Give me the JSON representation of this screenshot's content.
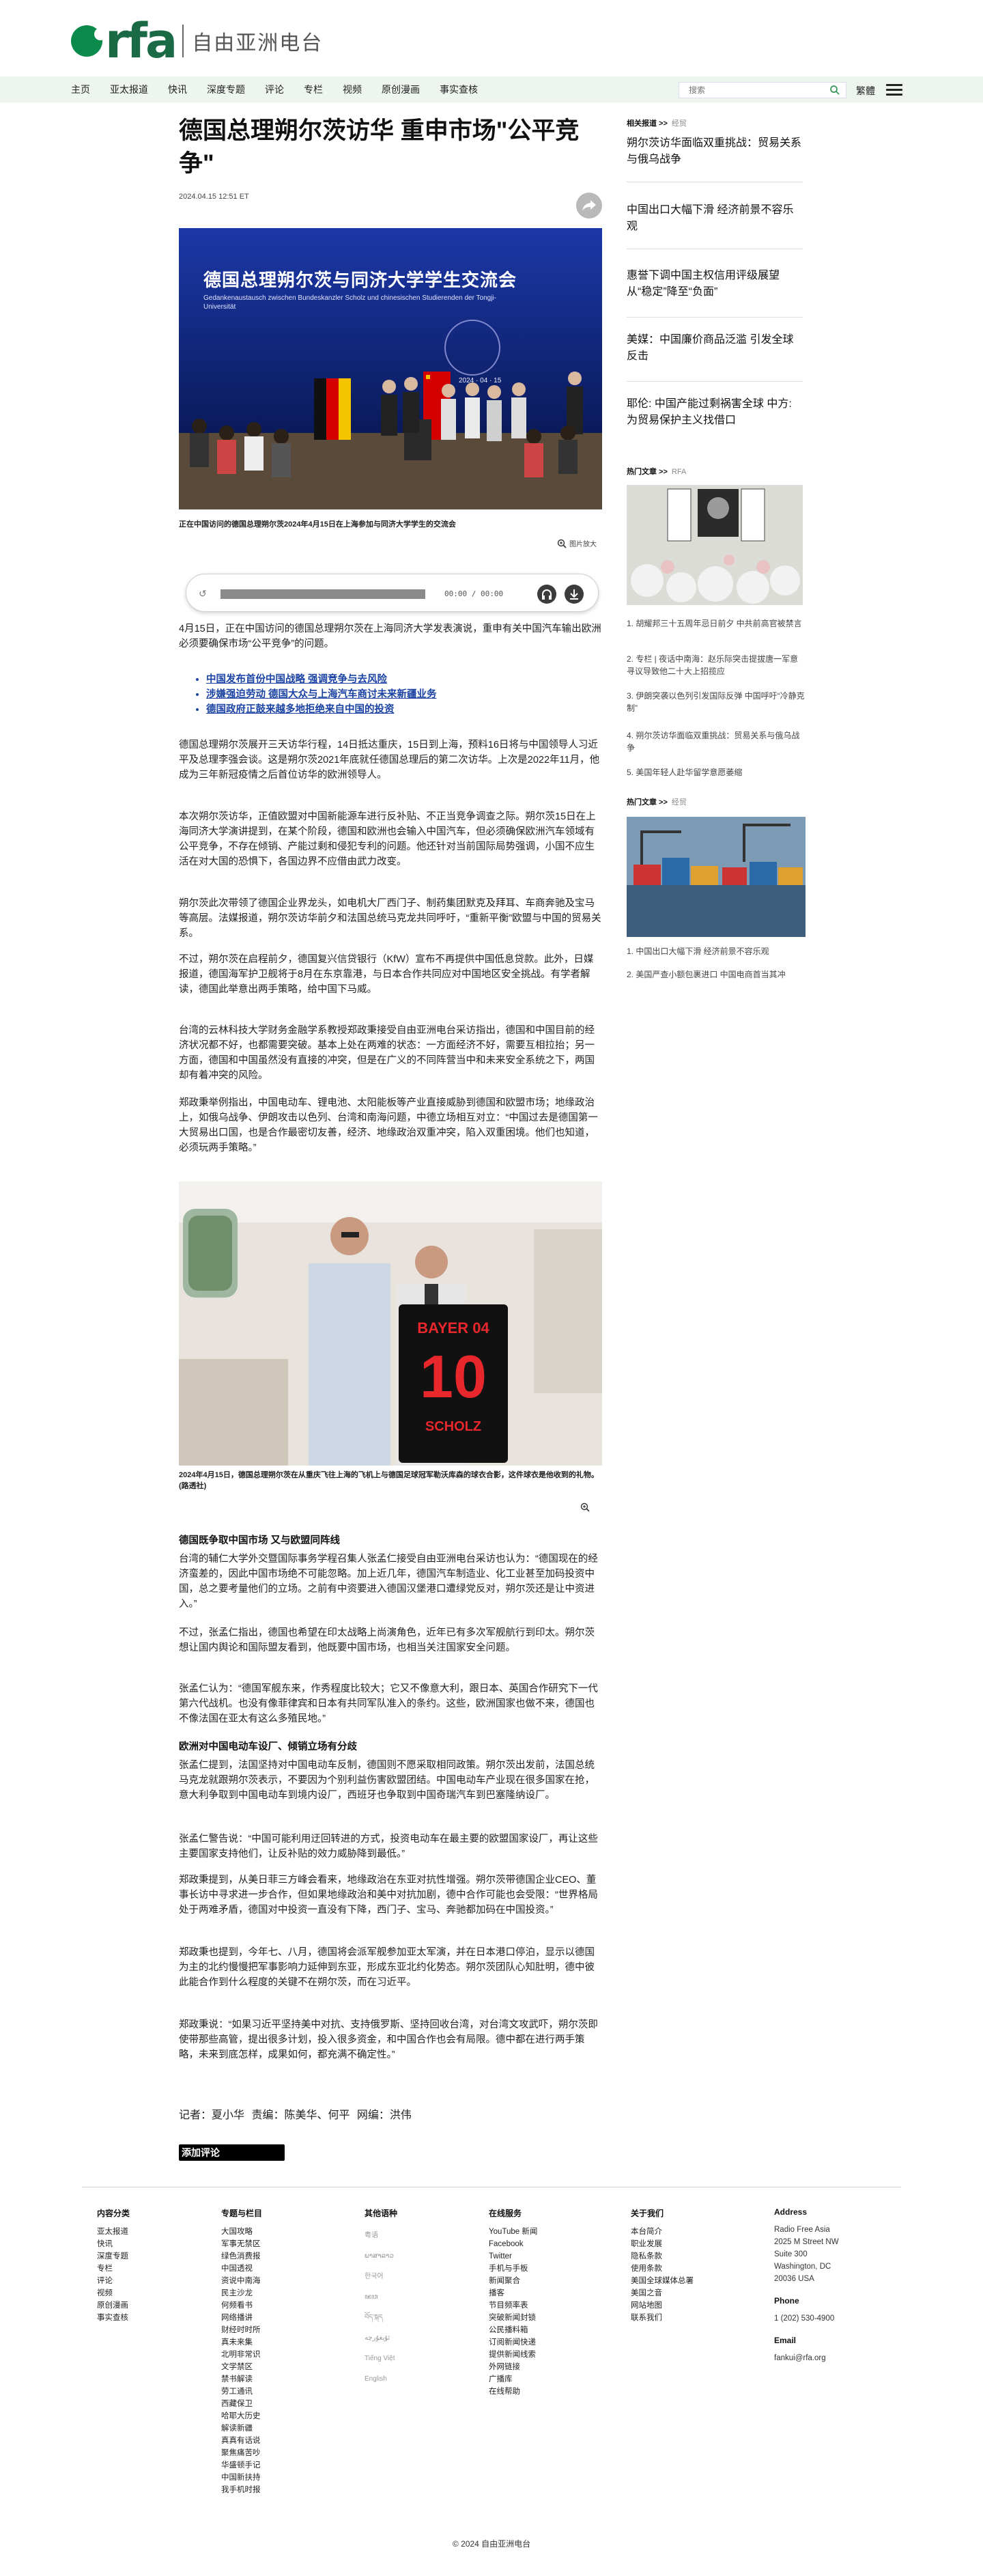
{
  "brand": {
    "logo": "rfa",
    "name": "自由亚洲电台"
  },
  "nav": {
    "items": [
      "主页",
      "亚太报道",
      "快讯",
      "深度专题",
      "评论",
      "专栏",
      "视频",
      "原创漫画",
      "事实查核"
    ],
    "search_placeholder": "搜索",
    "lang_toggle": "繁體"
  },
  "article": {
    "title": "德国总理朔尔茨访华 重申市场\"公平竞争\"",
    "timestamp": "2024.04.15 12:51 ET",
    "image1_caption": "正在中国访问的德国总理朔尔茨2024年4月15日在上海参加与同济大学学生的交流会",
    "image1_banner_cn": "德国总理朔尔茨与同济大学学生交流会",
    "image1_banner_de": "Gedankenaustausch zwischen Bundeskanzler Scholz und chinesischen Studierenden der Tongji-Universität",
    "image1_date": "2024 · 04 · 15",
    "zoom_label": "图片放大",
    "audio_time": "00:00 / 00:00",
    "lead": "4月15日，正在中国访问的德国总理朔尔茨在上海同济大学发表演说，重申有关中国汽车输出欧洲必须要确保市场“公平竞争”的问题。",
    "related": [
      "中国发布首份中国战略 强调竞争与去风险",
      "涉嫌强迫劳动 德国大众与上海汽车商讨未来新疆业务",
      "德国政府正鼓来越多地拒绝来自中国的投资"
    ],
    "paragraphs_a": [
      "德国总理朔尔茨展开三天访华行程，14日抵达重庆，15日到上海，预料16日将与中国领导人习近平及总理李强会谈。这是朔尔茨2021年底就任德国总理后的第二次访华。上次是2022年11月，他成为三年新冠疫情之后首位访华的欧洲领导人。",
      "本次朔尔茨访华，正值欧盟对中国新能源车进行反补贴、不正当竞争调查之际。朔尔茨15日在上海同济大学演讲提到，在某个阶段，德国和欧洲也会输入中国汽车，但必须确保欧洲汽车领域有公平竞争，不存在倾销、产能过剩和侵犯专利的问题。他还针对当前国际局势强调，小国不应生活在对大国的恐惧下，各国边界不应借由武力改变。",
      "朔尔茨此次带领了德国企业界龙头，如电机大厂西门子、制药集团默克及拜耳、车商奔驰及宝马等高层。法媒报道，朔尔茨访华前夕和法国总统马克龙共同呼吁，“重新平衡”欧盟与中国的贸易关系。",
      "不过，朔尔茨在启程前夕，德国复兴信贷银行（KfW）宣布不再提供中国低息贷款。此外，日媒报道，德国海军护卫舰将于8月在东京靠港，与日本合作共同应对中国地区安全挑战。有学者解读，德国此举意出两手策略，给中国下马威。",
      "台湾的云林科技大学财务金融学系教授郑政秉接受自由亚洲电台采访指出，德国和中国目前的经济状况都不好，也都需要突破。基本上处在两难的状态：一方面经济不好，需要互相拉抬；另一方面，德国和中国虽然没有直接的冲突，但是在广义的不同阵营当中和未来安全系统之下，两国却有着冲突的风险。",
      "郑政秉举例指出，中国电动车、锂电池、太阳能板等产业直接威胁到德国和欧盟市场；地缘政治上，如俄乌战争、伊朗攻击以色列、台湾和南海问题，中德立场相互对立：“中国过去是德国第一大贸易出口国，也是合作最密切友善，经济、地缘政治双重冲突，陷入双重困境。他们也知道，必须玩两手策略。”"
    ],
    "image2_caption": "2024年4月15日，德国总理朔尔茨在从重庆飞往上海的飞机上与德国足球冠军勒沃库森的球衣合影，这件球衣是他收到的礼物。(路透社)",
    "jersey_top": "BAYER 04",
    "jersey_number": "10",
    "jersey_name": "SCHOLZ",
    "subhead_1": "德国既争取中国市场 又与欧盟同阵线",
    "paragraphs_b": [
      "台湾的辅仁大学外交暨国际事务学程召集人张孟仁接受自由亚洲电台采访也认为：“德国现在的经济蛮差的，因此中国市场绝不可能忽略。加上近几年，德国汽车制造业、化工业甚至加码投资中国，总之要考量他们的立场。之前有中资要进入德国汉堡港口遭绿党反对，朔尔茨还是让中资进入。”",
      "不过，张孟仁指出，德国也希望在印太战略上尚演角色，近年已有多次军舰航行到印太。朔尔茨想让国内舆论和国际盟友看到，他既要中国市场，也相当关注国家安全问题。",
      "张孟仁认为：“德国军舰东来，作秀程度比较大；它又不像意大利，跟日本、英国合作研究下一代第六代战机。也没有像菲律宾和日本有共同军队准入的条约。这些，欧洲国家也做不来，德国也不像法国在亚太有这么多殖民地。”"
    ],
    "subhead_2": "欧洲对中国电动车设厂、倾销立场有分歧",
    "paragraphs_c": [
      "张孟仁提到，法国坚持对中国电动车反制，德国则不愿采取相同政策。朔尔茨出发前，法国总统马克龙就跟朔尔茨表示，不要因为个别利益伤害欧盟团结。中国电动车产业现在很多国家在抢，意大利争取到中国电动车到境内设厂，西班牙也争取到中国奇瑞汽车到巴塞隆纳设厂。",
      "张孟仁警告说：“中国可能利用迂回转进的方式，投资电动车在最主要的欧盟国家设厂，再让这些主要国家支持他们，让反补贴的效力威胁降到最低。”",
      "郑政秉提到，从美日菲三方峰会看来，地缘政治在东亚对抗性增强。朔尔茨带德国企业CEO、董事长访中寻求进一步合作，但如果地缘政治和美中对抗加剧，德中合作可能也会受限：“世界格局处于两难矛盾，德国对中投资一直没有下降，西门子、宝马、奔驰都加码在中国投资。”",
      "郑政秉也提到，今年七、八月，德国将会派军舰参加亚太军演，并在日本港口停泊，显示以德国为主的北约慢慢把军事影响力延伸到东亚，形成东亚北约化势态。朔尔茨团队心知肚明，德中彼此能合作到什么程度的关键不在朔尔茨，而在习近平。",
      "郑政秉说：“如果习近平坚持美中对抗、支持俄罗斯、坚持回收台湾，对台湾文攻武吓，朔尔茨即使带那些高管，提出很多计划，投入很多资金，和中国合作也会有局限。德中都在进行两手策略，未来到底怎样，成果如何，都充满不确定性。”"
    ],
    "byline": "记者：夏小华 责编：陈美华、何平 网编：洪伟",
    "comment_button": "添加评论"
  },
  "sidebar": {
    "related_head": "相关报道 >>",
    "related_sub": "经贸",
    "related_stories": [
      "朔尔茨访华面临双重挑战：贸易关系与俄乌战争",
      "中国出口大幅下滑 经济前景不容乐观",
      "惠誉下调中国主权信用评级展望 从“稳定”降至“负面”",
      "美媒：中国廉价商品泛滥 引发全球反击",
      "耶伦: 中国产能过剩祸害全球 中方: 为贸易保护主义找借口"
    ],
    "hot1_head": "热门文章 >>",
    "hot1_sub": "RFA",
    "hot1_items": [
      "1. 胡耀邦三十五周年忌日前夕 中共前高官被禁言",
      "2. 专栏 | 夜话中南海：赵乐际突击提拔唐一军意寻议导致他二十大上招揽应",
      "3. 伊朗突袭以色列引发国际反弹 中国呼吁“冷静克制”",
      "4. 朔尔茨访华面临双重挑战：贸易关系与俄乌战争",
      "5. 美国年轻人赴华留学意愿萎缩"
    ],
    "hot2_head": "热门文章 >>",
    "hot2_sub": "经贸",
    "hot2_items": [
      "1. 中国出口大幅下滑 经济前景不容乐观",
      "2. 美国严查小额包裹进口 中国电商首当其冲"
    ]
  },
  "footer": {
    "col1": {
      "head": "内容分类",
      "items": [
        "亚太报道",
        "快讯",
        "深度专题",
        "专栏",
        "评论",
        "视频",
        "原创漫画",
        "事实查核"
      ]
    },
    "col2": {
      "head": "专题与栏目",
      "items": [
        "大国攻略",
        "军事无禁区",
        "绿色消费报",
        "中国透视",
        "资说中南海",
        "民主沙龙",
        "何频看书",
        "网络播讲",
        "财经时时所",
        "真未来集",
        "北明非常识",
        "文学禁区",
        "禁书解读",
        "劳工通讯",
        "西藏保卫",
        "哈耶大历史",
        "解读新疆",
        "真真有话说",
        "聚焦痛苦吵",
        "华盛顿手记",
        "中国新扶持",
        "我手机时报"
      ]
    },
    "col3": {
      "head": "其他语种",
      "items": [
        "粤语",
        "ພາສາລາວ",
        "한국어",
        "ꦗꦮ",
        "བོད་སྐད",
        "ئۇيغۇرچە",
        "Tiếng Việt",
        "English"
      ]
    },
    "col4": {
      "head": "在线服务",
      "items": [
        "YouTube 新闻",
        "Facebook",
        "Twitter",
        "手机与手板",
        "新闻聚合",
        "播客",
        "节目频率表",
        "突破新闻封锁",
        "公民播料箱",
        "订阅新闻快递",
        "提供新闻线索",
        "外网链接",
        "广播库",
        "在线帮助"
      ]
    },
    "col5": {
      "head": "关于我们",
      "items": [
        "本台简介",
        "职业发展",
        "隐私条款",
        "使用条款",
        "美国全球媒体总署",
        "美国之音",
        "网站地图",
        "联系我们"
      ]
    },
    "address": {
      "head": "Address",
      "lines": [
        "Radio Free Asia",
        "2025 M Street NW",
        "Suite 300",
        "Washington, DC",
        "20036 USA"
      ],
      "phone_head": "Phone",
      "phone": "1 (202) 530-4900",
      "email_head": "Email",
      "email": "fankui@rfa.org"
    },
    "copyright": "© 2024 自由亚洲电台"
  },
  "colors": {
    "brand_green": "#1a6b45",
    "nav_bg": "#eef5ef",
    "link_blue": "#1b43a3"
  }
}
